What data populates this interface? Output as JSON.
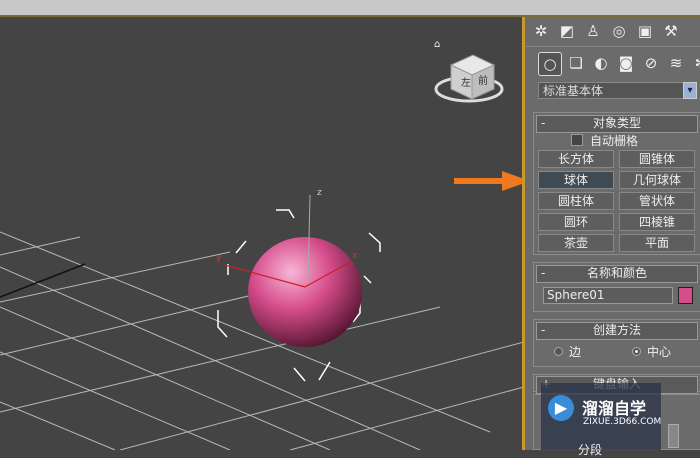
{
  "panel": {
    "top_icons": [
      "sun-icon",
      "modify-icon",
      "hierarchy-icon",
      "motion-icon",
      "display-icon",
      "utilities-icon"
    ],
    "create_icons": [
      "geometry-icon",
      "shapes-icon",
      "lights-icon",
      "cameras-icon",
      "helpers-icon",
      "spacewarps-icon",
      "systems-icon"
    ],
    "category_select": "标准基本体",
    "object_type": {
      "title": "对象类型",
      "collapse": "-",
      "autogrid": "自动栅格",
      "buttons": [
        "长方体",
        "圆锥体",
        "球体",
        "几何球体",
        "圆柱体",
        "管状体",
        "圆环",
        "四棱锥",
        "茶壶",
        "平面"
      ],
      "active_button": "球体"
    },
    "name_color": {
      "title": "名称和颜色",
      "collapse": "-",
      "name_value": "Sphere01",
      "color": "#d64d8c"
    },
    "creation_method": {
      "title": "创建方法",
      "collapse": "-",
      "option_edge": "边",
      "option_center": "中心",
      "selected": "中心"
    },
    "keyboard_entry": {
      "collapse": "+",
      "title": "键盘输入"
    },
    "segments_label": "分段"
  },
  "viewport": {
    "viewcube_top": "左",
    "viewcube_front": "前",
    "axis_x": "x",
    "axis_y": "y",
    "axis_z": "z",
    "sphere_color": "#d64d8c",
    "arrow_color": "#f07820"
  },
  "watermark": {
    "title": "溜溜自学",
    "url": "ZIXUE.3D66.COM"
  }
}
